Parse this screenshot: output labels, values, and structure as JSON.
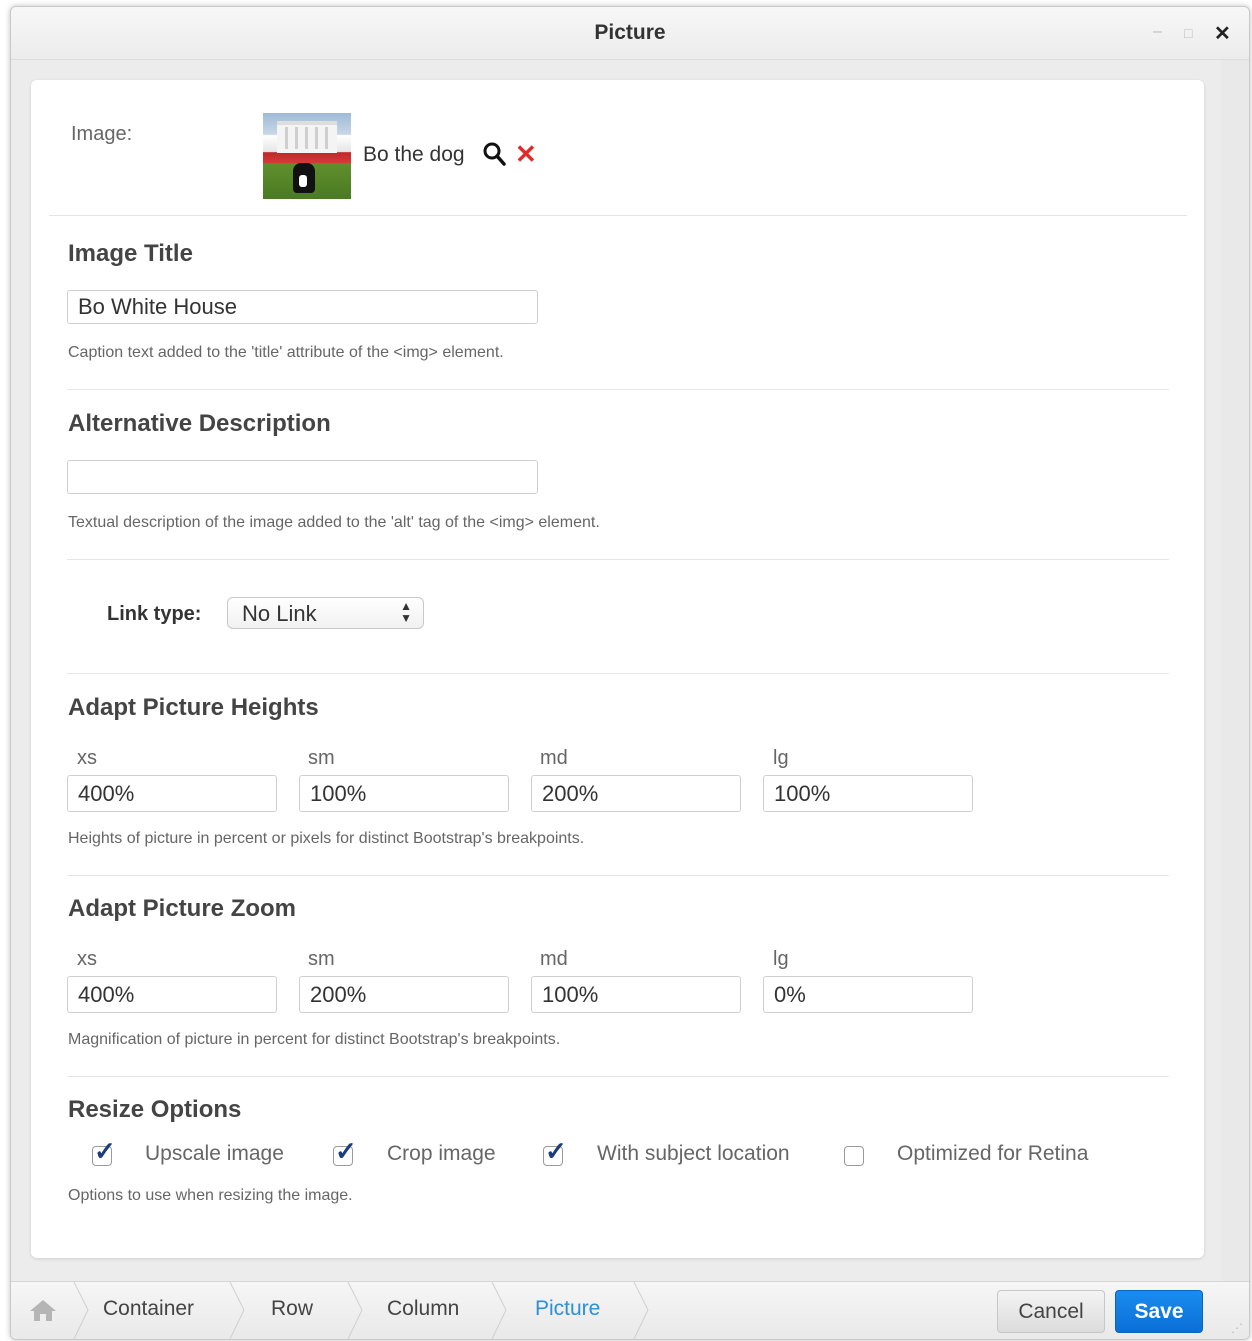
{
  "window": {
    "title": "Picture"
  },
  "image": {
    "label": "Image:",
    "file_name": "Bo the dog"
  },
  "image_title": {
    "heading": "Image Title",
    "value": "Bo White House",
    "help": "Caption text added to the 'title' attribute of the <img> element."
  },
  "alt": {
    "heading": "Alternative Description",
    "value": "",
    "help": "Textual description of the image added to the 'alt' tag of the <img> element."
  },
  "link": {
    "label": "Link type:",
    "selected": "No Link"
  },
  "heights": {
    "heading": "Adapt Picture Heights",
    "fields": [
      {
        "label": "xs",
        "value": "400%"
      },
      {
        "label": "sm",
        "value": "100%"
      },
      {
        "label": "md",
        "value": "200%"
      },
      {
        "label": "lg",
        "value": "100%"
      }
    ],
    "help": "Heights of picture in percent or pixels for distinct Bootstrap's breakpoints."
  },
  "zoom": {
    "heading": "Adapt Picture Zoom",
    "fields": [
      {
        "label": "xs",
        "value": "400%"
      },
      {
        "label": "sm",
        "value": "200%"
      },
      {
        "label": "md",
        "value": "100%"
      },
      {
        "label": "lg",
        "value": "0%"
      }
    ],
    "help": "Magnification of picture in percent for distinct Bootstrap's breakpoints."
  },
  "resize": {
    "heading": "Resize Options",
    "options": [
      {
        "label": "Upscale image",
        "checked": true
      },
      {
        "label": "Crop image",
        "checked": true
      },
      {
        "label": "With subject location",
        "checked": true
      },
      {
        "label": "Optimized for Retina",
        "checked": false
      }
    ],
    "help": "Options to use when resizing the image."
  },
  "breadcrumb": [
    {
      "label": "Container"
    },
    {
      "label": "Row"
    },
    {
      "label": "Column"
    },
    {
      "label": "Picture",
      "active": true
    }
  ],
  "buttons": {
    "cancel": "Cancel",
    "save": "Save"
  },
  "colors": {
    "accent": "#2a90d8",
    "primary_button": "#0a6fd6",
    "remove": "#e12b2b",
    "checkmark": "#1b3d7a"
  },
  "icons": [
    "home-icon",
    "magnifier-icon",
    "remove-icon",
    "select-arrows-icon"
  ]
}
